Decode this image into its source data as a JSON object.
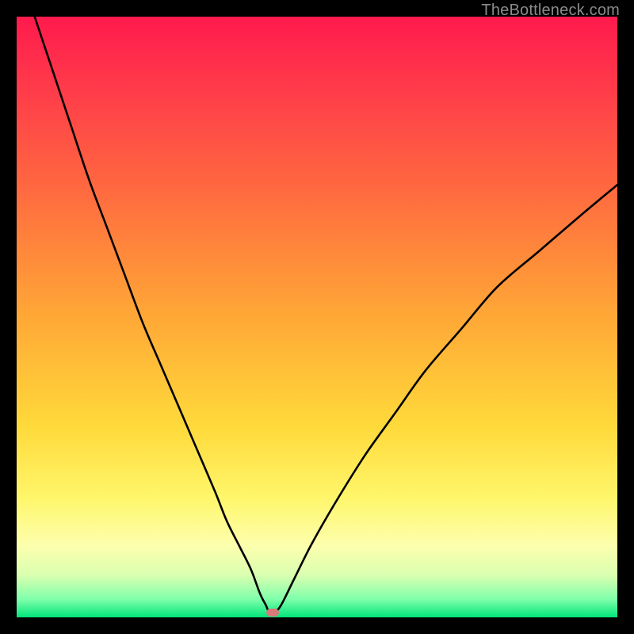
{
  "watermark": "TheBottleneck.com",
  "chart_data": {
    "type": "line",
    "title": "",
    "xlabel": "",
    "ylabel": "",
    "xlim": [
      0,
      100
    ],
    "ylim": [
      0,
      100
    ],
    "grid": false,
    "legend": false,
    "series": [
      {
        "name": "curve",
        "color": "#000000",
        "x": [
          3,
          6,
          9,
          12,
          15,
          18,
          21,
          24,
          27,
          30,
          33,
          35,
          37,
          39,
          40.5,
          41.5,
          42,
          43,
          44,
          46,
          49,
          53,
          58,
          63,
          68,
          74,
          80,
          87,
          94,
          100
        ],
        "y": [
          100,
          91,
          82,
          73,
          65,
          57,
          49,
          42,
          35,
          28,
          21,
          16,
          12,
          8,
          4,
          2,
          1,
          1,
          2,
          6,
          12,
          19,
          27,
          34,
          41,
          48,
          55,
          61,
          67,
          72
        ]
      }
    ],
    "marker": {
      "x": 42.6,
      "y": 0.8,
      "color": "#d97a7a"
    },
    "background_gradient": {
      "stops": [
        {
          "pct": 0,
          "color": "#ff1a4d"
        },
        {
          "pct": 12,
          "color": "#ff3b4a"
        },
        {
          "pct": 28,
          "color": "#ff6740"
        },
        {
          "pct": 50,
          "color": "#ffa836"
        },
        {
          "pct": 68,
          "color": "#ffd93a"
        },
        {
          "pct": 80,
          "color": "#fff66a"
        },
        {
          "pct": 88,
          "color": "#fdffad"
        },
        {
          "pct": 93,
          "color": "#d9ffb0"
        },
        {
          "pct": 97,
          "color": "#7fffaa"
        },
        {
          "pct": 100,
          "color": "#00e57a"
        }
      ]
    }
  }
}
